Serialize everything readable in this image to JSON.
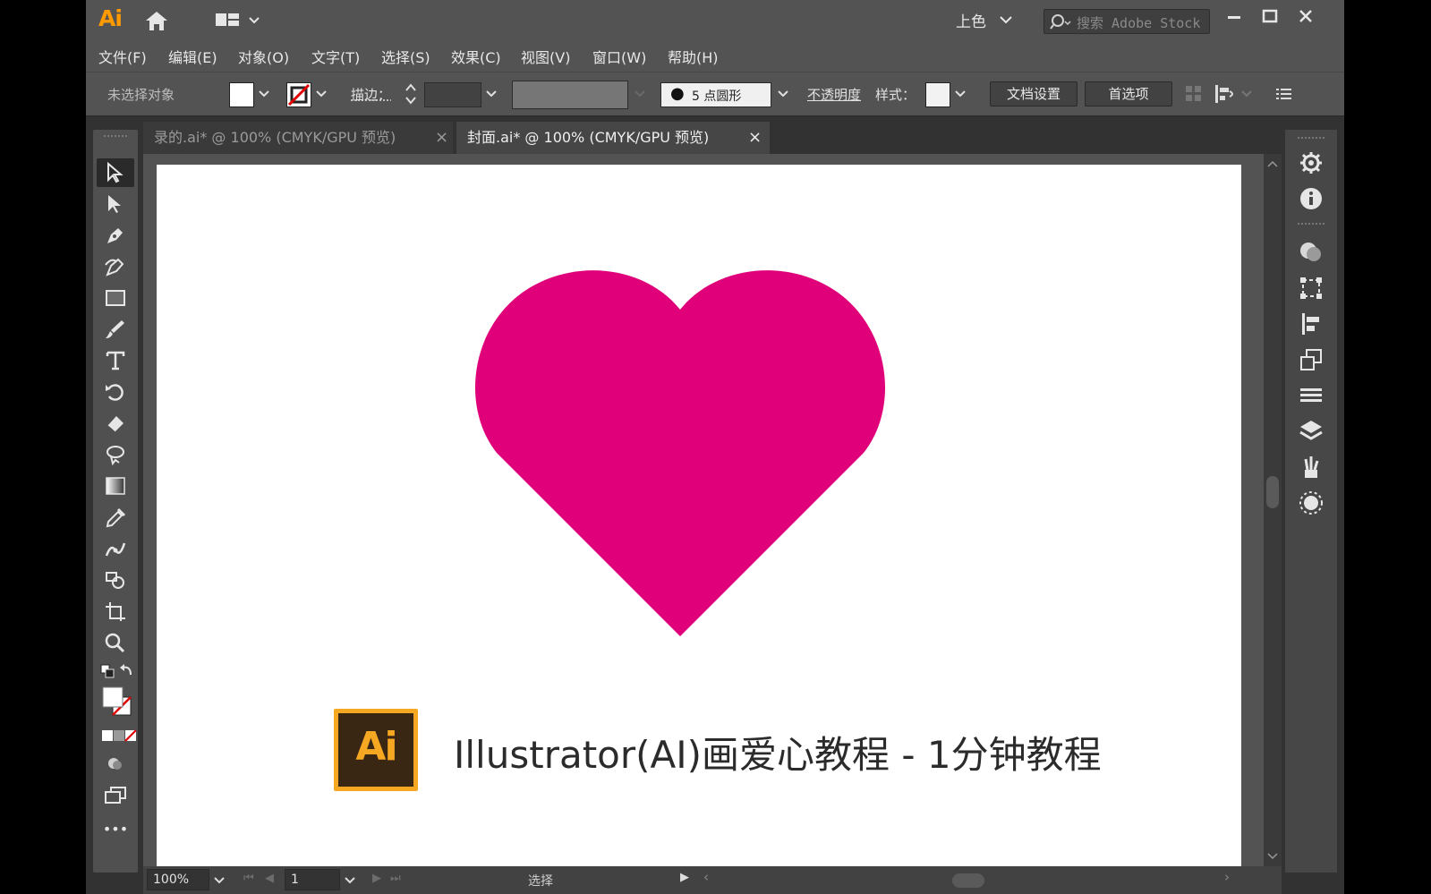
{
  "app": {
    "logo_text": "Ai",
    "workspace": "上色",
    "search_placeholder": "搜索 Adobe Stock",
    "accent": "#ff9a00"
  },
  "menu": [
    {
      "label": "文件(F)"
    },
    {
      "label": "编辑(E)"
    },
    {
      "label": "对象(O)"
    },
    {
      "label": "文字(T)"
    },
    {
      "label": "选择(S)"
    },
    {
      "label": "效果(C)"
    },
    {
      "label": "视图(V)"
    },
    {
      "label": "窗口(W)"
    },
    {
      "label": "帮助(H)"
    }
  ],
  "control": {
    "selection_status": "未选择对象",
    "stroke_label": "描边：",
    "brush_label": "5 点圆形",
    "opacity_label": "不透明度",
    "style_label": "样式：",
    "doc_setup_button": "文档设置",
    "preferences_button": "首选项"
  },
  "tabs": [
    {
      "label": "录的.ai* @ 100% (CMYK/GPU 预览)",
      "close": "×",
      "active": false
    },
    {
      "label": "封面.ai* @ 100% (CMYK/GPU 预览)",
      "close": "×",
      "active": true
    }
  ],
  "artboard": {
    "heart_color": "#e0007a",
    "badge_text": "Ai",
    "caption": "Illustrator(AI)画爱心教程 - 1分钟教程"
  },
  "status": {
    "zoom": "100%",
    "artboard_number": "1",
    "tool_name": "选择"
  },
  "toolbar": {
    "more_label": "•••"
  }
}
